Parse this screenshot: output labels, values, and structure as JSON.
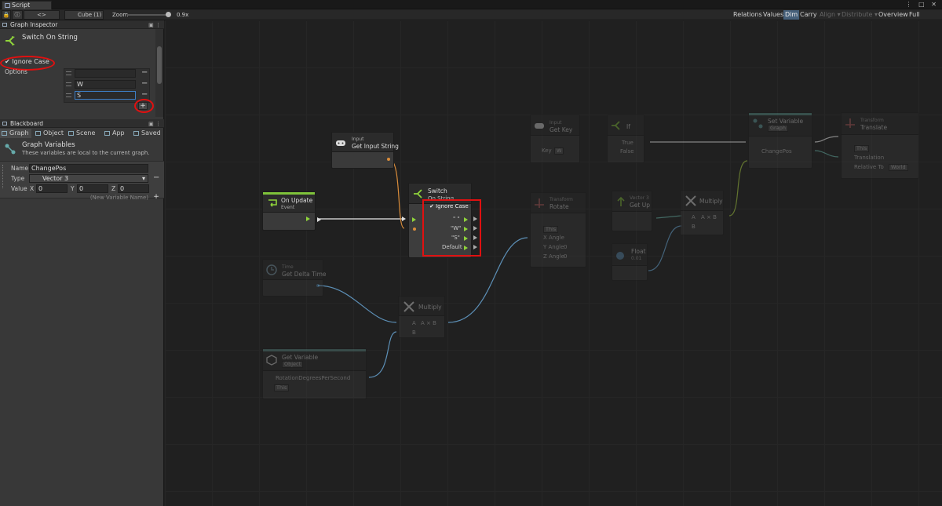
{
  "window": {
    "tab_title": "Script Graph",
    "controls": "⋮ □ ✕"
  },
  "toolbar": {
    "object_name": "Cube (1)",
    "zoom_label": "Zoom",
    "zoom_value": "0.9x",
    "right_buttons": [
      "Relations",
      "Values",
      "Dim",
      "Carry",
      "Align ▾",
      "Distribute ▾",
      "Overview",
      "Full Screen"
    ]
  },
  "inspector": {
    "header": "Graph Inspector",
    "node_title": "Switch On String",
    "ignore_case_label": "Ignore Case",
    "ignore_case_checked": true,
    "options_label": "Options",
    "options": [
      "",
      "W",
      "S"
    ],
    "add_label": "+",
    "remove_label": "−"
  },
  "blackboard": {
    "header": "Blackboard",
    "tabs": [
      "Graph",
      "Object",
      "Scene",
      "App",
      "Saved"
    ],
    "title": "Graph Variables",
    "description": "These variables are local to the current graph.",
    "variable": {
      "name_label": "Name",
      "name": "ChangePos",
      "type_label": "Type",
      "type": "Vector 3",
      "value_label": "Value",
      "x_label": "X",
      "x": "0",
      "y_label": "Y",
      "y": "0",
      "z_label": "Z",
      "z": "0"
    },
    "new_variable_placeholder": "(New Variable Name)",
    "add_label": "+"
  },
  "nodes": {
    "on_update": {
      "title": "On Update",
      "subtitle": "Event"
    },
    "input_string": {
      "subtitle": "Input",
      "title": "Get Input String"
    },
    "switch": {
      "title": "Switch",
      "title2": "On String",
      "ignore_case": "Ignore Case",
      "outputs": [
        "\" \"",
        "\"W\"",
        "\"S\"",
        "Default"
      ]
    },
    "delta_time": {
      "subtitle": "Time",
      "title": "Get Delta Time"
    },
    "multiply_a": {
      "title": "Multiply",
      "in_a": "A",
      "out": "A × B",
      "in_b": "B"
    },
    "get_variable_a": {
      "title": "Get Variable",
      "kind": "Object",
      "var": "RotationDegreesPerSecond",
      "target": "This"
    },
    "get_key": {
      "subtitle": "Input",
      "title": "Get Key",
      "key_label": "Key",
      "key": "W"
    },
    "if": {
      "title": "If",
      "true_label": "True",
      "false_label": "False"
    },
    "set_variable": {
      "title": "Set Variable",
      "kind": "Graph",
      "var": "ChangePos"
    },
    "translate": {
      "subtitle": "Transform",
      "title": "Translate",
      "target": "This",
      "translation": "Translation",
      "relative_label": "Relative To",
      "relative": "World"
    },
    "rotate": {
      "subtitle": "Transform",
      "title": "Rotate",
      "target": "This",
      "x": "X Angle",
      "y": "Y Angle",
      "y_val": "0",
      "z": "Z Angle",
      "z_val": "0"
    },
    "vector3": {
      "subtitle": "Vector 3",
      "title": "Get Up"
    },
    "multiply_b": {
      "title": "Multiply",
      "in_a": "A",
      "out": "A × B",
      "in_b": "B"
    },
    "float": {
      "title": "Float",
      "value": "0.01"
    }
  },
  "colors": {
    "flow": "#8fd33b",
    "highlight": "#e01010",
    "event": "#8fd33b",
    "variable": "#5a8c88"
  }
}
